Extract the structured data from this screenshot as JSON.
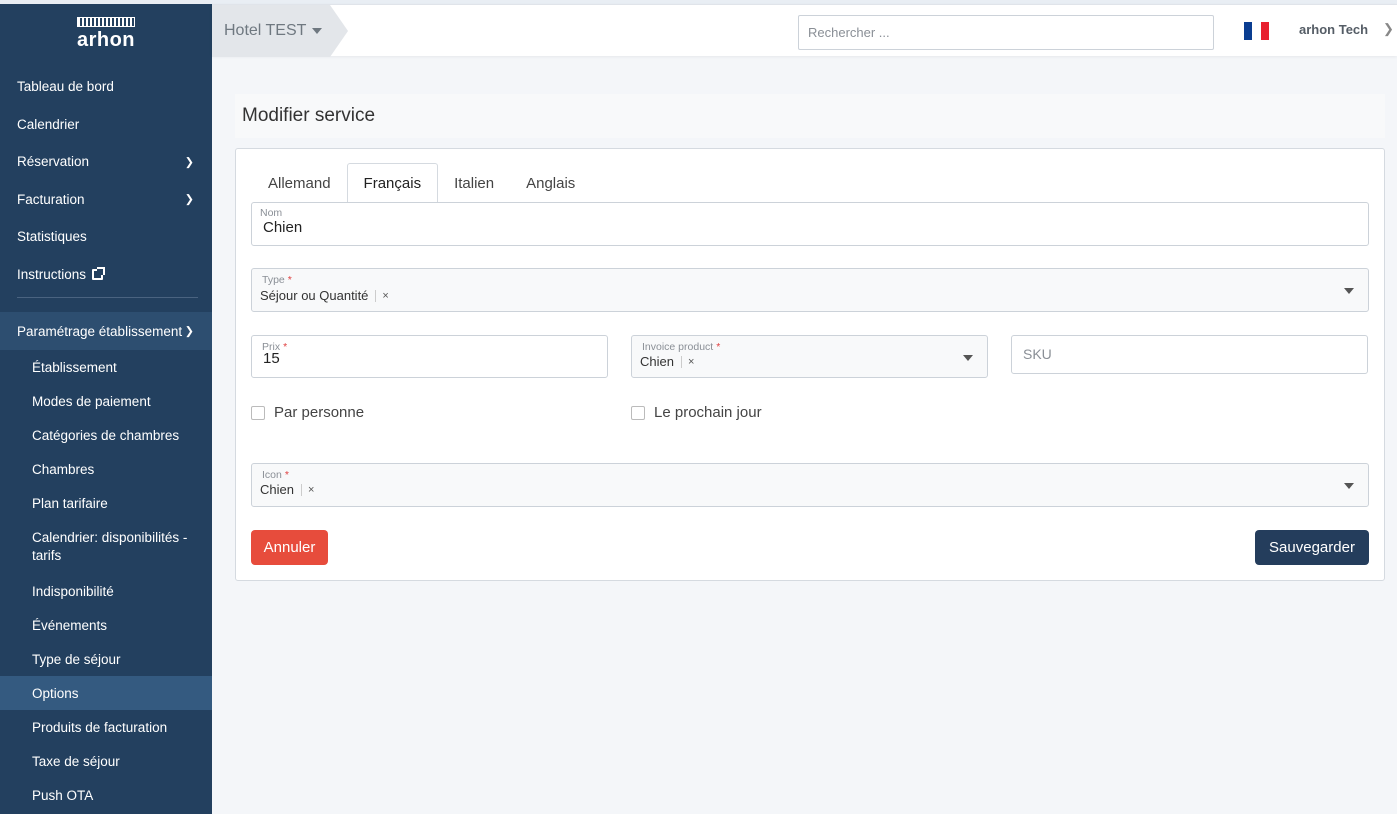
{
  "sidebar": {
    "logo_text": "arhon",
    "items": [
      {
        "label": "Tableau de bord"
      },
      {
        "label": "Calendrier"
      },
      {
        "label": "Réservation"
      },
      {
        "label": "Facturation"
      },
      {
        "label": "Statistiques"
      },
      {
        "label": "Instructions"
      }
    ],
    "section": {
      "label": "Paramétrage établissement"
    },
    "sub_items": [
      {
        "label": "Établissement"
      },
      {
        "label": "Modes de paiement"
      },
      {
        "label": "Catégories de chambres"
      },
      {
        "label": "Chambres"
      },
      {
        "label": "Plan tarifaire"
      },
      {
        "label": "Calendrier: disponibilités - tarifs"
      },
      {
        "label": "Indisponibilité"
      },
      {
        "label": "Événements"
      },
      {
        "label": "Type de séjour"
      },
      {
        "label": "Options"
      },
      {
        "label": "Produits de facturation"
      },
      {
        "label": "Taxe de séjour"
      },
      {
        "label": "Push OTA"
      }
    ],
    "active_sub_item": "Options"
  },
  "topbar": {
    "hotel": "Hotel TEST",
    "search_placeholder": "Rechercher ...",
    "flag_colors": [
      "#0a3d91",
      "#ffffff",
      "#e8202f"
    ],
    "user": "arhon Tech"
  },
  "page": {
    "title": "Modifier service"
  },
  "tabs": [
    "Allemand",
    "Français",
    "Italien",
    "Anglais"
  ],
  "active_tab": "Français",
  "form": {
    "nom_label": "Nom",
    "nom_value": "Chien",
    "type_label": "Type",
    "type_value": "Séjour ou Quantité",
    "prix_label": "Prix",
    "prix_value": "15",
    "invoice_label": "Invoice product",
    "invoice_value": "Chien",
    "sku_placeholder": "SKU",
    "par_personne": "Par personne",
    "prochain_jour": "Le prochain jour",
    "icon_label": "Icon",
    "icon_value": "Chien",
    "required_mark": "*",
    "clear_mark": "×"
  },
  "buttons": {
    "cancel": "Annuler",
    "save": "Sauvegarder"
  },
  "colors": {
    "sidebar": "#23405f",
    "cancel": "#e74c3c",
    "save": "#243d5c"
  }
}
